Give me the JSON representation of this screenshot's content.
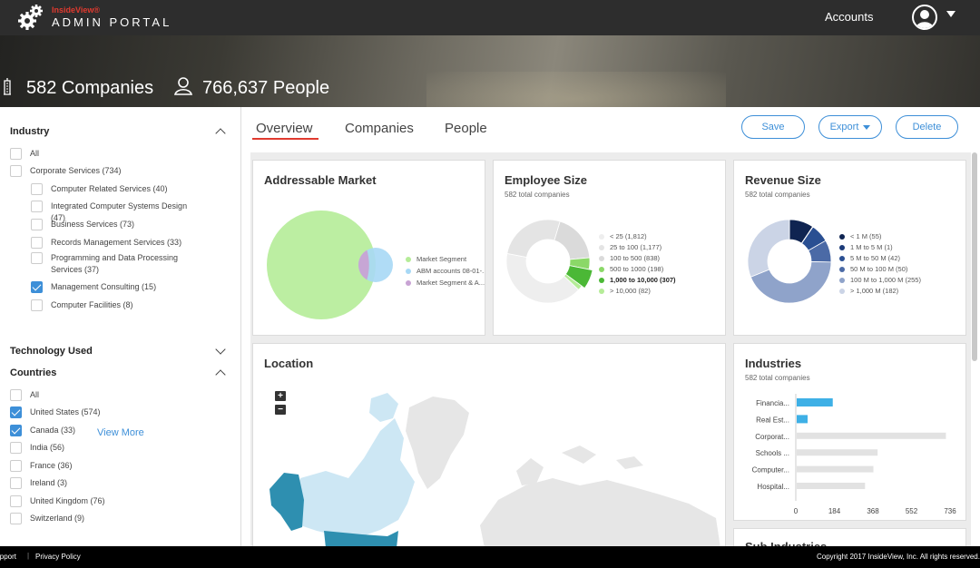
{
  "header": {
    "brand_top": "InsideView®",
    "brand_bottom": "ADMIN PORTAL",
    "accounts_label": "Accounts"
  },
  "stats": {
    "companies": "582 Companies",
    "people": "766,637 People"
  },
  "filters": {
    "industry": {
      "title": "Industry",
      "items": [
        {
          "label": "All",
          "checked": false,
          "indent": 0
        },
        {
          "label": "Corporate Services (734)",
          "checked": false,
          "indent": 0
        },
        {
          "label": "Computer Related Services (40)",
          "checked": false,
          "indent": 1
        },
        {
          "label": "Integrated Computer Systems Design (47)",
          "checked": false,
          "indent": 1
        },
        {
          "label": "Business Services (73)",
          "checked": false,
          "indent": 1
        },
        {
          "label": "Records Management Services (33)",
          "checked": false,
          "indent": 1
        },
        {
          "label": "Programming and Data Processing Services (37)",
          "checked": false,
          "indent": 1
        },
        {
          "label": "Management Consulting (15)",
          "checked": true,
          "indent": 1
        },
        {
          "label": "Computer Facilities (8)",
          "checked": false,
          "indent": 1
        }
      ],
      "view_more": "View More"
    },
    "technology": {
      "title": "Technology Used"
    },
    "countries": {
      "title": "Countries",
      "items": [
        {
          "label": "All",
          "checked": false
        },
        {
          "label": "United States (574)",
          "checked": true
        },
        {
          "label": "Canada (33)",
          "checked": true
        },
        {
          "label": "India (56)",
          "checked": false
        },
        {
          "label": "France (36)",
          "checked": false
        },
        {
          "label": "Ireland (3)",
          "checked": false
        },
        {
          "label": "United Kingdom (76)",
          "checked": false
        },
        {
          "label": "Switzerland (9)",
          "checked": false
        }
      ]
    }
  },
  "tabs": [
    {
      "label": "Overview",
      "active": true
    },
    {
      "label": "Companies",
      "active": false
    },
    {
      "label": "People",
      "active": false
    }
  ],
  "actions": {
    "save": "Save",
    "export": "Export",
    "delete": "Delete"
  },
  "addressable_market": {
    "title": "Addressable Market",
    "legend": [
      {
        "label": "Market Segment",
        "color": "#b5ec98"
      },
      {
        "label": "ABM accounts 08-01-...",
        "color": "#a7d8f5"
      },
      {
        "label": "Market Segment & A...",
        "color": "#c8a3d4"
      }
    ]
  },
  "employee_size": {
    "title": "Employee Size",
    "subtitle": "582 total companies",
    "legend": [
      {
        "label": "< 25 (1,812)",
        "color": "#eeeeee",
        "value": 1812
      },
      {
        "label": "25 to 100 (1,177)",
        "color": "#e4e4e4",
        "value": 1177
      },
      {
        "label": "100 to 500 (838)",
        "color": "#dadada",
        "value": 838
      },
      {
        "label": "500 to 1000 (198)",
        "color": "#8bd868",
        "value": 198
      },
      {
        "label": "1,000 to 10,000 (307)",
        "color": "#4bb836",
        "value": 307,
        "selected": true
      },
      {
        "label": "> 10,000 (82)",
        "color": "#b5ec98",
        "value": 82
      }
    ]
  },
  "revenue_size": {
    "title": "Revenue Size",
    "subtitle": "582 total companies",
    "legend": [
      {
        "label": "< 1 M (55)",
        "color": "#0f2451",
        "value": 55
      },
      {
        "label": "1 M to 5 M (1)",
        "color": "#1b3a78",
        "value": 1
      },
      {
        "label": "5 M to 50 M (42)",
        "color": "#2a4f92",
        "value": 42
      },
      {
        "label": "50 M to 100 M (50)",
        "color": "#4b6aa6",
        "value": 50
      },
      {
        "label": "100 M to 1,000 M (255)",
        "color": "#8fa3ca",
        "value": 255
      },
      {
        "label": "> 1,000 M (182)",
        "color": "#cbd4e6",
        "value": 182
      }
    ]
  },
  "location": {
    "title": "Location",
    "zoom_in": "+",
    "zoom_out": "−"
  },
  "industries": {
    "title": "Industries",
    "subtitle": "582 total companies",
    "chart_data": {
      "type": "bar",
      "orientation": "horizontal",
      "categories": [
        "Financia...",
        "Real Est...",
        "Corporat...",
        "Schools ...",
        "Computer...",
        "Hospital..."
      ],
      "values": [
        160,
        20,
        712,
        386,
        366,
        326
      ],
      "highlight_values": [
        172,
        52,
        0,
        0,
        0,
        0
      ],
      "xticks": [
        "0",
        "184",
        "368",
        "552",
        "736"
      ],
      "xlim": [
        0,
        736
      ],
      "colors": {
        "base": "#e2e2e2",
        "highlight": "#3eb0e6"
      }
    }
  },
  "next_card_title": "Sub Industries",
  "footer": {
    "support": "Support",
    "privacy": "Privacy Policy",
    "copyright": "Copyright 2017 InsideView, Inc. All rights reserved."
  }
}
